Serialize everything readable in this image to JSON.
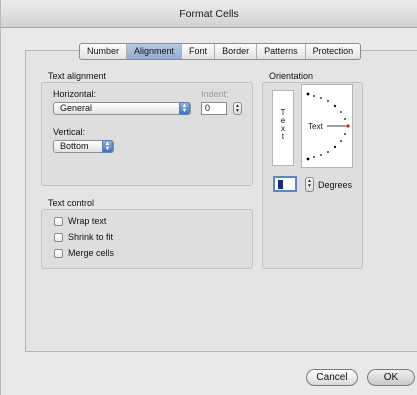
{
  "window": {
    "title": "Format Cells"
  },
  "tabs": [
    "Number",
    "Alignment",
    "Font",
    "Border",
    "Patterns",
    "Protection"
  ],
  "active_tab": "Alignment",
  "text_alignment": {
    "section_label": "Text alignment",
    "horizontal_label": "Horizontal:",
    "horizontal_value": "General",
    "indent_label": "Indent:",
    "indent_value": "0",
    "vertical_label": "Vertical:",
    "vertical_value": "Bottom"
  },
  "text_control": {
    "section_label": "Text control",
    "options": [
      {
        "label": "Wrap text",
        "checked": false
      },
      {
        "label": "Shrink to fit",
        "checked": false
      },
      {
        "label": "Merge cells",
        "checked": false
      }
    ]
  },
  "orientation": {
    "section_label": "Orientation",
    "vertical_text": "T e x t",
    "dial_text": "Text",
    "degrees_label": "Degrees",
    "degrees_value": ""
  },
  "buttons": {
    "cancel": "Cancel",
    "ok": "OK"
  },
  "colors": {
    "accent": "#3f74c0",
    "dial_indicator": "#d81c1c"
  }
}
